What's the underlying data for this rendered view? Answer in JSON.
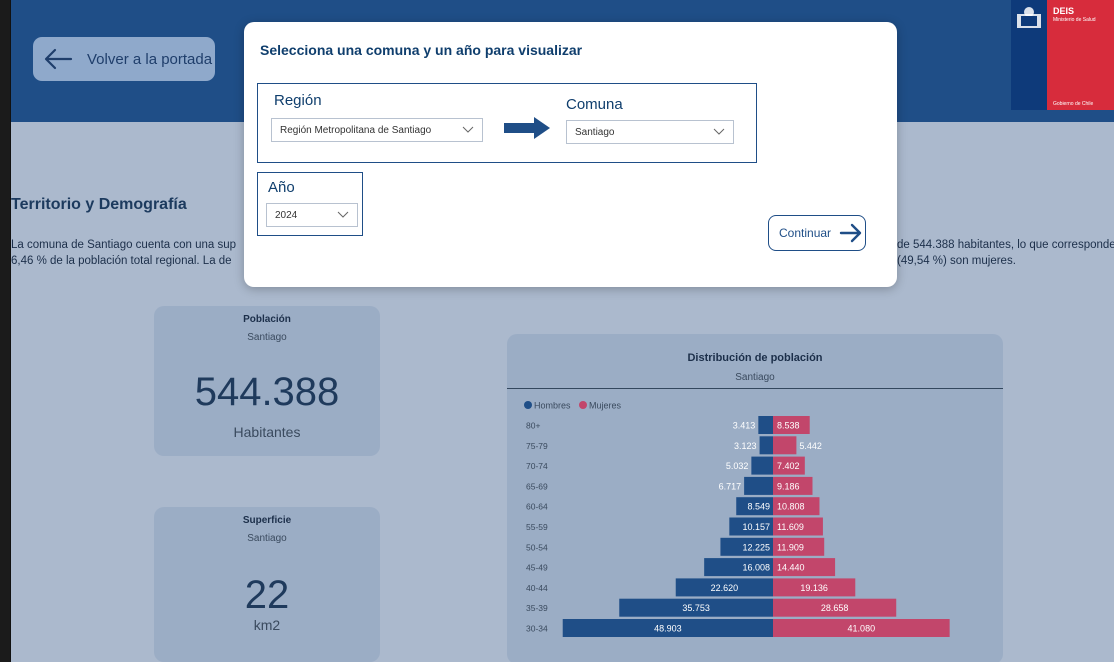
{
  "header": {
    "back_label": "Volver a la portada",
    "logo_name": "DEIS",
    "logo_ministry": "Ministerio de Salud",
    "logo_gov": "Gobierno de Chile"
  },
  "section": {
    "title": "Territorio y Demografía",
    "paragraph_left_1": "La comuna de Santiago cuenta con una sup",
    "paragraph_left_2": "6,46 % de la población total regional. La de",
    "paragraph_right_1": "de 544.388 habitantes, lo que corresponde",
    "paragraph_right_2": "(49,54 %) son mujeres."
  },
  "modal": {
    "title": "Selecciona una comuna y un año para visualizar",
    "region_label": "Región",
    "region_value": "Región Metropolitana de Santiago",
    "comuna_label": "Comuna",
    "comuna_value": "Santiago",
    "anio_label": "Año",
    "anio_value": "2024",
    "continue_label": "Continuar"
  },
  "kpi_population": {
    "title": "Población",
    "subtitle": "Santiago",
    "value": "544.388",
    "unit": "Habitantes"
  },
  "kpi_surface": {
    "title": "Superficie",
    "subtitle": "Santiago",
    "value": "22",
    "unit": "km2"
  },
  "colors": {
    "hombres": "#1f4e87",
    "mujeres": "#c2466b",
    "header": "#1f4e87"
  },
  "chart_data": {
    "type": "bar",
    "orientation": "horizontal-pyramid",
    "title": "Distribución de población",
    "subtitle": "Santiago",
    "legend": [
      "Hombres",
      "Mujeres"
    ],
    "categories": [
      "80+",
      "75-79",
      "70-74",
      "65-69",
      "60-64",
      "55-59",
      "50-54",
      "45-49",
      "40-44",
      "35-39",
      "30-34"
    ],
    "series": [
      {
        "name": "Hombres",
        "values": [
          3413,
          3123,
          5032,
          6717,
          8549,
          10157,
          12225,
          16008,
          22620,
          35753,
          48903
        ],
        "labels": [
          "3.413",
          "3.123",
          "5.032",
          "6.717",
          "8.549",
          "10.157",
          "12.225",
          "16.008",
          "22.620",
          "35.753",
          "48.903"
        ]
      },
      {
        "name": "Mujeres",
        "values": [
          8538,
          5442,
          7402,
          9186,
          10808,
          11609,
          11909,
          14440,
          19136,
          28658,
          41080
        ],
        "labels": [
          "8.538",
          "5.442",
          "7.402",
          "9.186",
          "10.808",
          "11.609",
          "11.909",
          "14.440",
          "19.136",
          "28.658",
          "41.080"
        ]
      }
    ]
  }
}
